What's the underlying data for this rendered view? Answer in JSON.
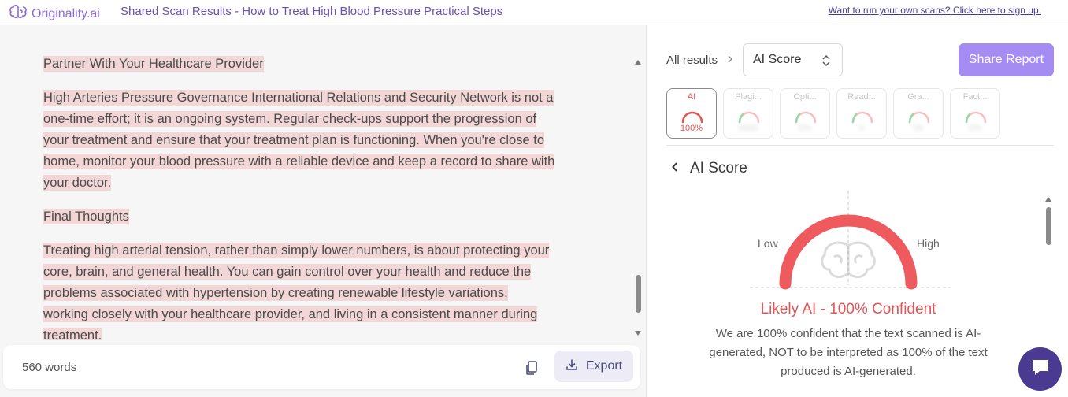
{
  "header": {
    "logo_text": "Originality.ai",
    "report_title": "Shared Scan Results - How to Treat High Blood Pressure Practical Steps",
    "signup_link": "Want to run your own scans? Click here to sign up."
  },
  "document": {
    "paragraphs": [
      "Partner With Your Healthcare Provider",
      "High Arteries Pressure Governance International Relations and Security Network is not a one-time effort; it is an ongoing system. Regular check-ups support the progression of your treatment and ensure that your treatment plan is functioning. When you're close to home, monitor your blood pressure with a reliable device and keep a record to share with your doctor.",
      "Final Thoughts",
      "Treating high arterial tension, rather than simply lower numbers, is about protecting your core, brain, and general health. You can gain control over your health and reduce the problems associated with hypertension by creating renewable lifestyle variations, working closely with your healthcare provider, and living in a consistent manner during treatment."
    ],
    "word_count": "560 words",
    "export_label": "Export",
    "scroll_position": 0.92
  },
  "results": {
    "all_results_label": "All results",
    "selected_score": "AI Score",
    "share_label": "Share Report",
    "tabs": [
      {
        "label": "AI",
        "value": "100%",
        "active": true
      },
      {
        "label": "Plagi...",
        "value": "0000",
        "active": false
      },
      {
        "label": "Opti...",
        "value": "0%",
        "active": false
      },
      {
        "label": "Read...",
        "value": "0",
        "active": false
      },
      {
        "label": "Gra...",
        "value": "00",
        "active": false
      },
      {
        "label": "Fact...",
        "value": "0%",
        "active": false
      }
    ],
    "section_title": "AI Score",
    "gauge": {
      "low_label": "Low",
      "high_label": "High",
      "ai_fraction": 1.0
    },
    "verdict": "Likely AI - 100% Confident",
    "explanation": "We are 100% confident that the text scanned is AI-generated, NOT to be interpreted as 100% of the text produced is AI-generated."
  },
  "colors": {
    "accent": "#a58cf2",
    "brand": "#4b3a91",
    "ai_red": "#e25656",
    "highlight": "#f3d6d6"
  },
  "icons": {
    "logo": "brain-logo-icon",
    "breadcrumb": "chevron-right-icon",
    "select": "updown-caret-icon",
    "copy": "copy-icon",
    "export": "download-icon",
    "back": "chevron-left-icon",
    "chat": "chat-icon"
  }
}
